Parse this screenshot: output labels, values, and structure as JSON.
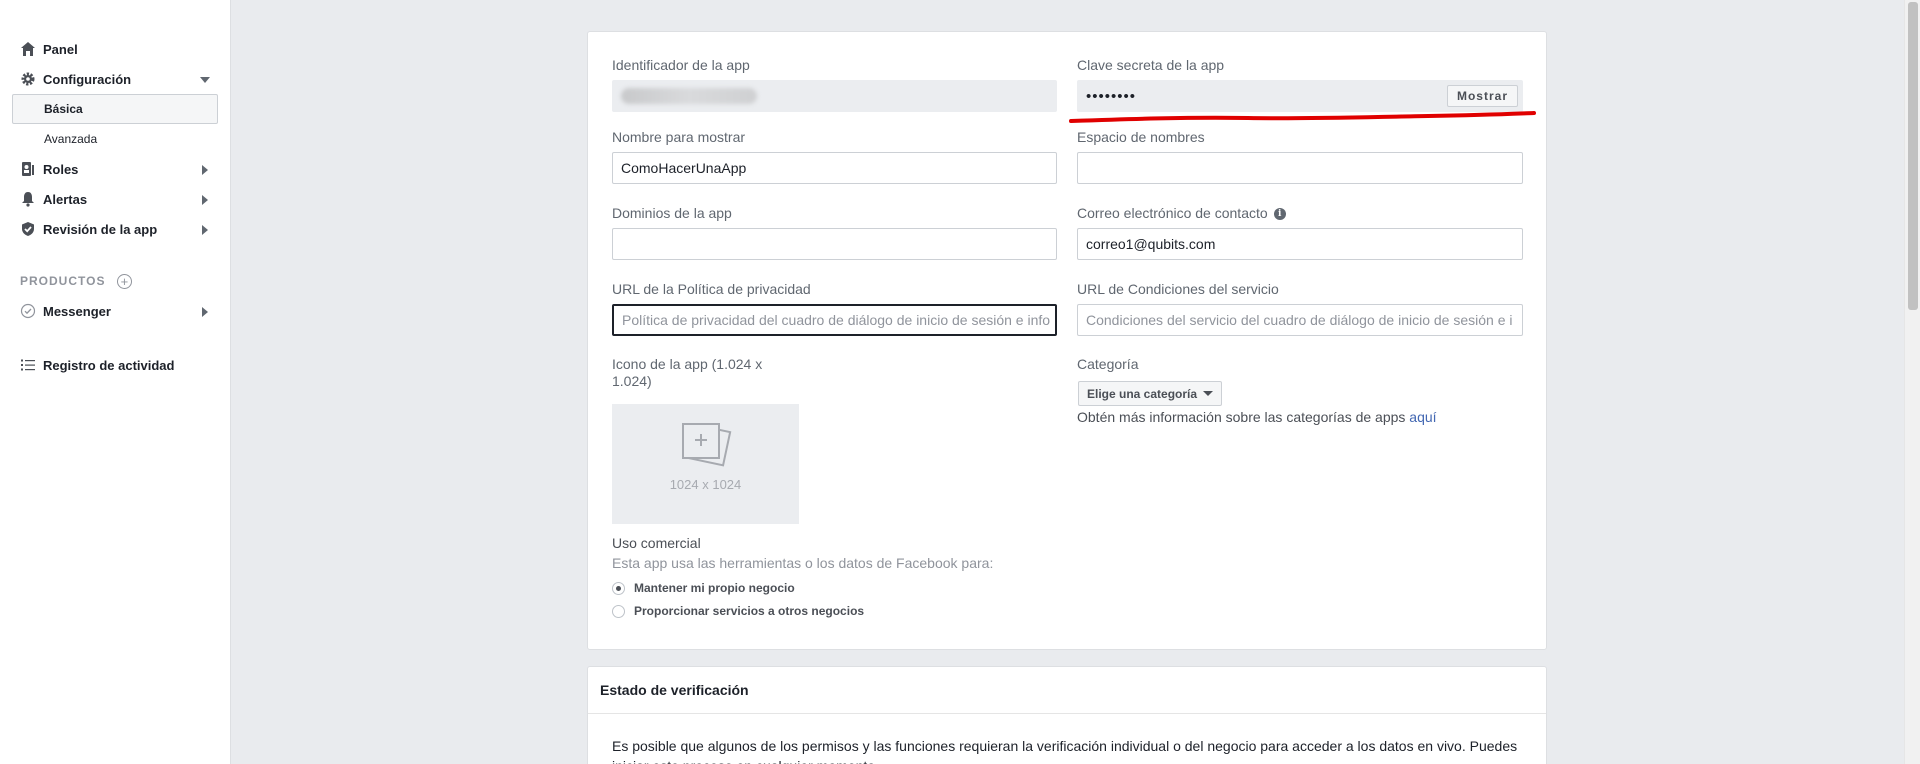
{
  "sidebar": {
    "panel": "Panel",
    "configuracion": "Configuración",
    "basica": "Básica",
    "avanzada": "Avanzada",
    "roles": "Roles",
    "alertas": "Alertas",
    "revision": "Revisión de la app",
    "productos": "PRODUCTOS",
    "messenger": "Messenger",
    "registro": "Registro de actividad"
  },
  "form": {
    "app_id_label": "Identificador de la app",
    "app_secret_label": "Clave secreta de la app",
    "app_secret_value": "••••••••",
    "show_button": "Mostrar",
    "display_name_label": "Nombre para mostrar",
    "display_name_value": "ComoHacerUnaApp",
    "namespace_label": "Espacio de nombres",
    "namespace_value": "",
    "domains_label": "Dominios de la app",
    "domains_value": "",
    "contact_email_label": "Correo electrónico de contacto",
    "contact_email_value": "correo1@qubits.com",
    "privacy_url_label": "URL de la Política de privacidad",
    "privacy_url_placeholder": "Política de privacidad del cuadro de diálogo de inicio de sesión e info",
    "terms_url_label": "URL de Condiciones del servicio",
    "terms_url_placeholder": "Condiciones del servicio del cuadro de diálogo de inicio de sesión e i",
    "icon_label_line1": "Icono de la app (1.024 x",
    "icon_label_line2": "1.024)",
    "icon_dimensions": "1024 x 1024",
    "category_label": "Categoría",
    "category_dropdown": "Elige una categoría",
    "category_info_text": "Obtén más información sobre las categorías de apps",
    "category_info_link": "aquí",
    "commercial_use_label": "Uso comercial",
    "commercial_use_desc": "Esta app usa las herramientas o los datos de Facebook para:",
    "commercial_options": [
      "Mantener mi propio negocio",
      "Proporcionar servicios a otros negocios"
    ],
    "commercial_selected": "Mantener mi propio negocio"
  },
  "verification": {
    "title": "Estado de verificación",
    "body": "Es posible que algunos de los permisos y las funciones requieran la verificación individual o del negocio para acceder a los datos en vivo. Puedes iniciar este proceso en cualquier momento."
  },
  "colors": {
    "annotation_underline": "#e00000",
    "link": "#4267b2"
  }
}
